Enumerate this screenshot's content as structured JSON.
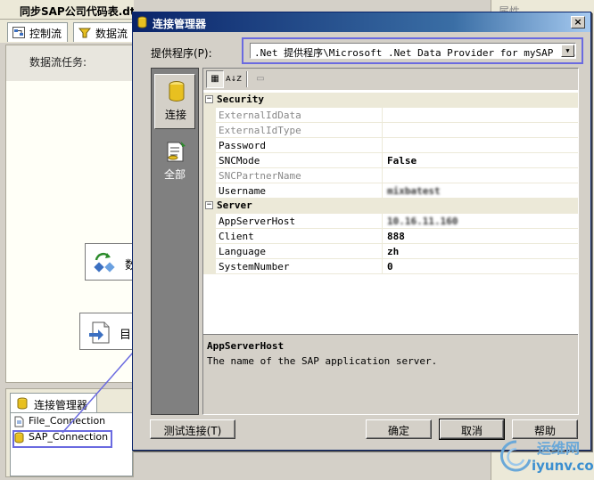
{
  "background": {
    "title": "同步SAP公司代码表.dt...",
    "tabs": [
      {
        "label": "控制流"
      },
      {
        "label": "数据流"
      }
    ],
    "task_label": "数据流任务:",
    "blocks": [
      {
        "label": "数"
      },
      {
        "label": "目"
      }
    ],
    "conn_panel": {
      "tab_label": "连接管理器",
      "items": [
        {
          "label": "File_Connection"
        },
        {
          "label": "SAP_Connection"
        }
      ]
    },
    "right_strip_title": "属性"
  },
  "dialog": {
    "title": "连接管理器",
    "close_glyph": "×",
    "provider_label": "提供程序(P):",
    "provider_value": ".Net 提供程序\\Microsoft .Net Data Provider for mySAP ...",
    "nav": [
      {
        "label": "连接"
      },
      {
        "label": "全部"
      }
    ],
    "toolbar": {
      "categorized": "▦",
      "alphabetical": "A↓Z",
      "pages": "▭"
    },
    "grid": {
      "security": {
        "name": "Security",
        "rows": [
          {
            "name": "ExternalIdData",
            "value": "",
            "disabled": true
          },
          {
            "name": "ExternalIdType",
            "value": "",
            "disabled": true
          },
          {
            "name": "Password",
            "value": "",
            "disabled": false
          },
          {
            "name": "SNCMode",
            "value": "False",
            "disabled": false
          },
          {
            "name": "SNCPartnerName",
            "value": "",
            "disabled": true
          },
          {
            "name": "Username",
            "value": "mixbatest",
            "disabled": false
          }
        ]
      },
      "server": {
        "name": "Server",
        "rows": [
          {
            "name": "AppServerHost",
            "value": "10.16.11.160"
          },
          {
            "name": "Client",
            "value": "888"
          },
          {
            "name": "Language",
            "value": "zh"
          },
          {
            "name": "SystemNumber",
            "value": "0"
          }
        ]
      }
    },
    "description": {
      "title": "AppServerHost",
      "text": "The name of the SAP application server."
    },
    "buttons": {
      "test": "测试连接(T)",
      "ok": "确定",
      "cancel": "取消",
      "help": "帮助"
    }
  },
  "watermark": {
    "text": "运维网",
    "url": "iyunv.com"
  },
  "colors": {
    "highlight": "#6a6ae0",
    "title_bar": "#0a246a"
  }
}
